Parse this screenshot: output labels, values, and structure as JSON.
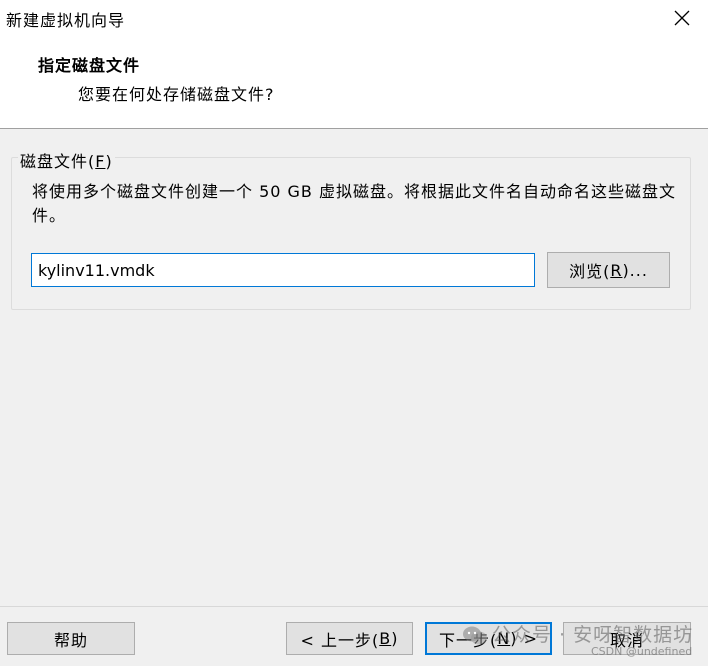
{
  "window": {
    "title": "新建虚拟机向导",
    "close_icon": "close-icon"
  },
  "header": {
    "heading": "指定磁盘文件",
    "subheading": "您要在何处存储磁盘文件?"
  },
  "disk_file_group": {
    "legend_prefix": "磁盘文件(",
    "legend_key": "F",
    "legend_suffix": ")",
    "description": "将使用多个磁盘文件创建一个 50 GB 虚拟磁盘。将根据此文件名自动命名这些磁盘文件。",
    "filename_value": "kylinv11.vmdk",
    "browse_prefix": "浏览(",
    "browse_key": "R",
    "browse_suffix": ")..."
  },
  "footer": {
    "help_label": "帮助",
    "back_prefix": "< 上一步(",
    "back_key": "B",
    "back_suffix": ")",
    "next_prefix": "下一步(",
    "next_key": "N",
    "next_suffix": ") >",
    "cancel_label": "取消"
  },
  "watermark": {
    "text": "公众号 · 安呀智数据坊",
    "icon": "wechat-icon",
    "csdn": "CSDN @undefined"
  },
  "colors": {
    "accent": "#0078d7",
    "button_bg": "#e1e1e1",
    "dialog_bg": "#f0f0f0"
  }
}
